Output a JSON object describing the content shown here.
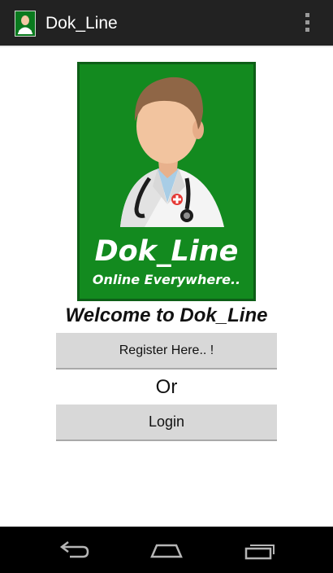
{
  "actionbar": {
    "title": "Dok_Line",
    "icon": "app-logo-icon",
    "overflow_icon": "overflow-menu-icon",
    "bg_color": "#222222"
  },
  "logo": {
    "title": "Dok_Line",
    "subtitle": "Online Everywhere..",
    "bg_color": "#138a1f",
    "image": "doctor-illustration"
  },
  "welcome_text": "Welcome to Dok_Line",
  "buttons": {
    "register_label": "Register Here.. !",
    "or_text": "Or",
    "login_label": "Login"
  },
  "navbar": {
    "back_icon": "back-icon",
    "home_icon": "home-icon",
    "recents_icon": "recent-apps-icon"
  }
}
